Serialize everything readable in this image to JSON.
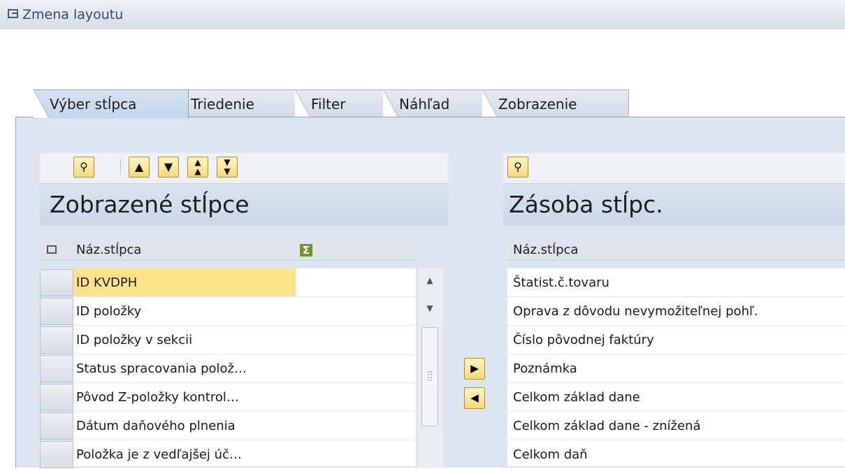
{
  "window": {
    "title": "Zmena layoutu"
  },
  "tabs": [
    {
      "label": "Výber stĺpca",
      "active": true
    },
    {
      "label": "Triedenie"
    },
    {
      "label": "Filter"
    },
    {
      "label": "Náhľad"
    },
    {
      "label": "Zobrazenie"
    }
  ],
  "left_panel": {
    "title": "Zobrazené stĺpce",
    "column_header": "Náz.stĺpca",
    "toolbar": [
      "binoculars-icon",
      "move-up-icon",
      "move-down-icon",
      "move-top-icon",
      "move-bottom-icon"
    ],
    "rows": [
      "ID KVDPH",
      "ID položky",
      "ID položky v sekcii",
      "Status spracovania polož…",
      "Pôvod Z-položky kontrol…",
      "Dátum daňového plnenia",
      "Položka je z vedľajšej úč…"
    ],
    "selected_row": 0
  },
  "right_panel": {
    "title": "Zásoba stĺpc.",
    "column_header": "Náz.stĺpca",
    "rows": [
      "Štatist.č.tovaru",
      "Oprava z dôvodu nevymožiteľnej pohľ.",
      "Číslo pôvodnej faktúry",
      "Poznámka",
      "Celkom základ dane",
      "Celkom základ dane - znížená",
      "Celkom daň"
    ]
  },
  "colors": {
    "selected_row": "#ffe38a",
    "button": "#f6d97a",
    "frame": "#dde6f0"
  }
}
